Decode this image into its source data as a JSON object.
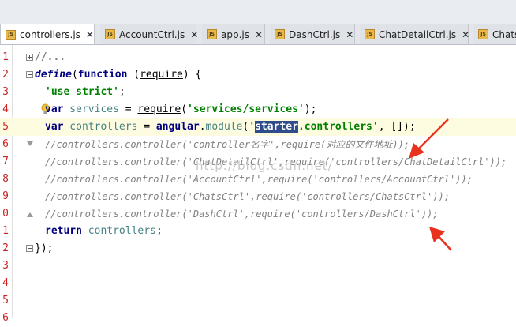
{
  "tabs": [
    {
      "label": "controllers.js",
      "active": true,
      "icon": "js-file-icon",
      "close": "✕"
    },
    {
      "label": "AccountCtrl.js",
      "active": false,
      "icon": "js-file-icon",
      "close": "✕"
    },
    {
      "label": "app.js",
      "active": false,
      "icon": "js-file-icon",
      "close": "✕"
    },
    {
      "label": "DashCtrl.js",
      "active": false,
      "icon": "js-file-icon",
      "close": "✕"
    },
    {
      "label": "ChatDetailCtrl.js",
      "active": false,
      "icon": "js-file-icon",
      "close": "✕"
    },
    {
      "label": "Chats",
      "active": false,
      "icon": "js-file-icon",
      "close": ""
    }
  ],
  "icon_text": "JS",
  "line_numbers": [
    "1",
    "2",
    "3",
    "4",
    "5",
    "6",
    "7",
    "8",
    "9",
    "0",
    "1",
    "2",
    "3",
    "4",
    "5",
    "6"
  ],
  "code": {
    "l1": "//...",
    "l2_kw": "define",
    "l2_p1": "(",
    "l2_kw2": "function",
    "l2_p2": " (",
    "l2_arg": "require",
    "l2_p3": ") {",
    "l3_str": "'use strict'",
    "l3_p": ";",
    "l4_kw": "var",
    "l4_var": " services",
    "l4_eq": " = ",
    "l4_fn": "require",
    "l4_p1": "(",
    "l4_str": "'services/services'",
    "l4_p2": ");",
    "l5_kw": "var",
    "l5_var": " controllers",
    "l5_eq": " = ",
    "l5_obj": "angular",
    "l5_dot": ".",
    "l5_fn": "module",
    "l5_p1": "(",
    "l5_q": "'",
    "l5_sel": "starter",
    "l5_str": ".controllers'",
    "l5_p2": ", []);",
    "l6": "//controllers.controller('controller名字',require(对应的文件地址));",
    "l7": "//controllers.controller('ChatDetailCtrl',require('controllers/ChatDetailCtrl'));",
    "l8": "//controllers.controller('AccountCtrl',require('controllers/AccountCtrl'));",
    "l9": "//controllers.controller('ChatsCtrl',require('controllers/ChatsCtrl'));",
    "l10": "//controllers.controller('DashCtrl',require('controllers/DashCtrl'));",
    "l11_kw": "return",
    "l11_var": " controllers",
    "l11_p": ";",
    "l12": "});"
  },
  "watermark": "http://blog.csdn.net/",
  "colors": {
    "arrow": "#e8321e",
    "line_number": "#cc2222",
    "selection": "#2f4d8a"
  }
}
